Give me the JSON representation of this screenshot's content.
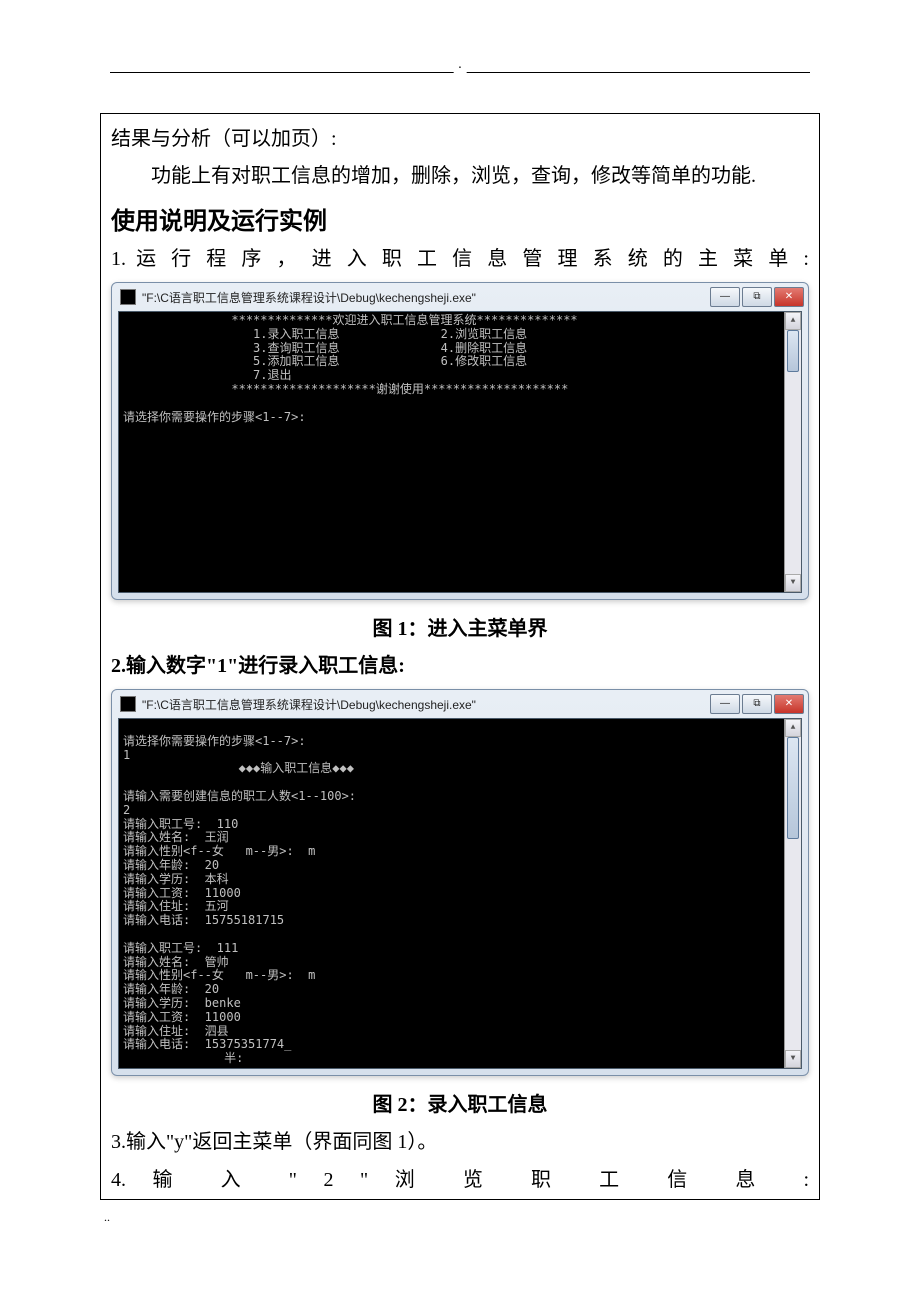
{
  "doc": {
    "resultsHeader": "结果与分析（可以加页）:",
    "summaryLine": "功能上有对职工信息的增加，删除，浏览，查询，修改等简单的功能.",
    "usageHeading": "使用说明及运行实例",
    "step1": "1. 运 行 程 序 ， 进 入 职 工 信 息 管 理 系 统 的 主 菜 单 :",
    "caption1": "图 1：进入主菜单界",
    "step2": "2.输入数字\"1\"进行录入职工信息:",
    "caption2": "图 2：录入职工信息",
    "step3": "3.输入\"y\"返回主菜单（界面同图 1）。",
    "step4": "4.   输 入 \" 2 \" 浏 览 职 工 信 息 :",
    "footer": ".."
  },
  "console1": {
    "title": "\"F:\\C语言职工信息管理系统课程设计\\Debug\\kechengsheji.exe\"",
    "body": "               **************欢迎进入职工信息管理系统**************\n                  1.录入职工信息              2.浏览职工信息\n                  3.查询职工信息              4.删除职工信息\n                  5.添加职工信息              6.修改职工信息\n                  7.退出\n               ********************谢谢使用********************\n\n请选择你需要操作的步骤<1--7>:"
  },
  "console2": {
    "title": "\"F:\\C语言职工信息管理系统课程设计\\Debug\\kechengsheji.exe\"",
    "body": "\n请选择你需要操作的步骤<1--7>:\n1\n                ◆◆◆输入职工信息◆◆◆\n\n请输入需要创建信息的职工人数<1--100>:\n2\n请输入职工号:  110\n请输入姓名:  王润\n请输入性别<f--女   m--男>:  m\n请输入年龄:  20\n请输入学历:  本科\n请输入工资:  11000\n请输入住址:  五河\n请输入电话:  15755181715\n\n请输入职工号:  111\n请输入姓名:  管帅\n请输入性别<f--女   m--男>:  m\n请输入年龄:  20\n请输入学历:  benke\n请输入工资:  11000\n请输入住址:  泗县\n请输入电话:  15375351774_\n              半:"
  },
  "winBtns": {
    "min": "—",
    "max": "⧉",
    "close": "✕"
  },
  "sb": {
    "up": "▲",
    "down": "▼"
  }
}
